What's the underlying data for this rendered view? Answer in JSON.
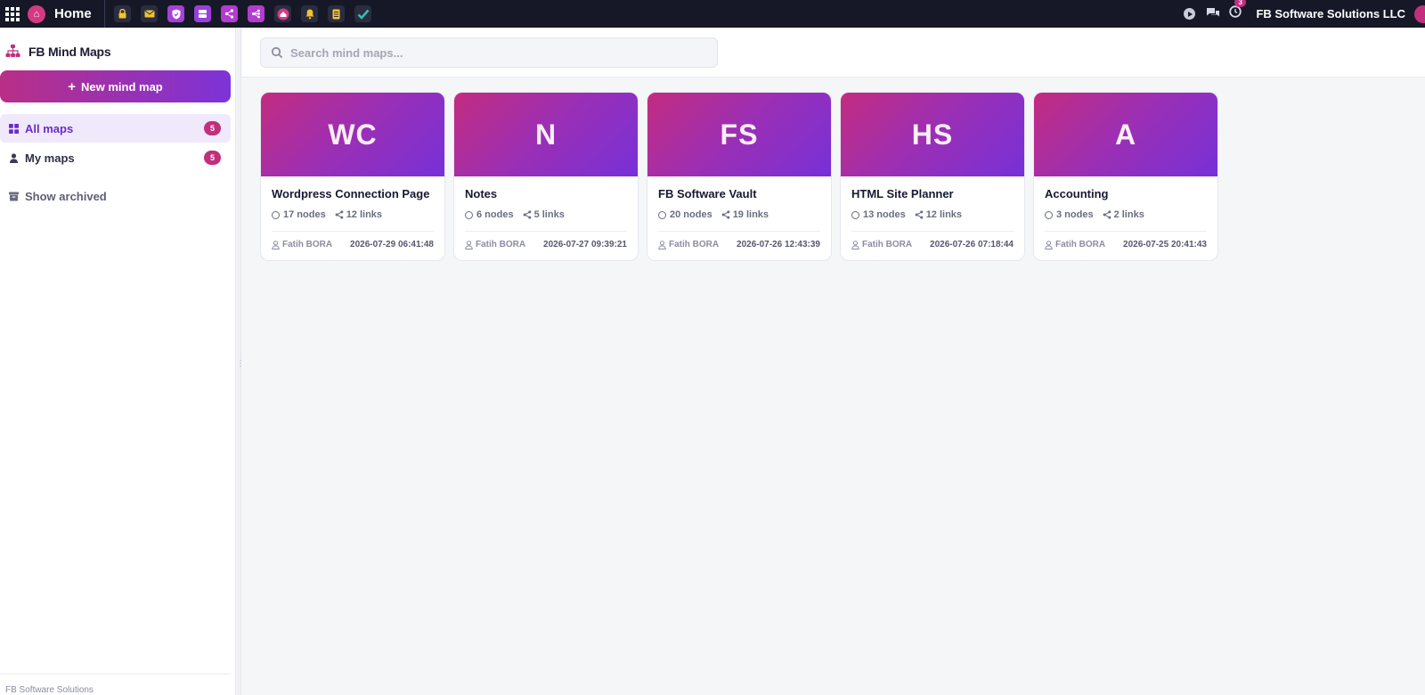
{
  "topbar": {
    "home_label": "Home",
    "company": "FB Software Solutions LLC",
    "notification_count": "3",
    "apps": [
      {
        "icon": "lock-icon",
        "color": "#2a2d40"
      },
      {
        "icon": "mail-icon",
        "color": "#2a2d40"
      },
      {
        "icon": "shield-icon",
        "color": "#a73fd9"
      },
      {
        "icon": "database-icon",
        "color": "#9a3fd9"
      },
      {
        "icon": "share-icon",
        "color": "#b43bd0"
      },
      {
        "icon": "mindmap-icon",
        "color": "#b43bd0"
      },
      {
        "icon": "home-app-icon",
        "color": "#2a2d40"
      },
      {
        "icon": "bell-icon",
        "color": "#2a2d40"
      },
      {
        "icon": "notebook-icon",
        "color": "#2a2d40"
      },
      {
        "icon": "check-icon",
        "color": "#2a2d40"
      }
    ]
  },
  "sidebar": {
    "title": "FB Mind Maps",
    "new_button": "New mind map",
    "nav": [
      {
        "label": "All maps",
        "count": "5",
        "active": true
      },
      {
        "label": "My maps",
        "count": "5",
        "active": false
      }
    ],
    "archived_label": "Show archived",
    "footer": "FB Software Solutions"
  },
  "search": {
    "placeholder": "Search mind maps..."
  },
  "maps": [
    {
      "initials": "WC",
      "title": "Wordpress Connection Page",
      "nodes": "17 nodes",
      "links": "12 links",
      "author": "Fatih BORA",
      "date": "2026-07-29 06:41:48"
    },
    {
      "initials": "N",
      "title": "Notes",
      "nodes": "6 nodes",
      "links": "5 links",
      "author": "Fatih BORA",
      "date": "2026-07-27 09:39:21"
    },
    {
      "initials": "FS",
      "title": "FB Software Vault",
      "nodes": "20 nodes",
      "links": "19 links",
      "author": "Fatih BORA",
      "date": "2026-07-26 12:43:39"
    },
    {
      "initials": "HS",
      "title": "HTML Site Planner",
      "nodes": "13 nodes",
      "links": "12 links",
      "author": "Fatih BORA",
      "date": "2026-07-26 07:18:44"
    },
    {
      "initials": "A",
      "title": "Accounting",
      "nodes": "3 nodes",
      "links": "2 links",
      "author": "Fatih BORA",
      "date": "2026-07-25 20:41:43"
    }
  ],
  "colors": {
    "brand_gradient_start": "#c32c80",
    "brand_gradient_end": "#7730d8",
    "badge": "#c0307c",
    "active_nav": "#6b2bd0",
    "topbar": "#161827"
  }
}
